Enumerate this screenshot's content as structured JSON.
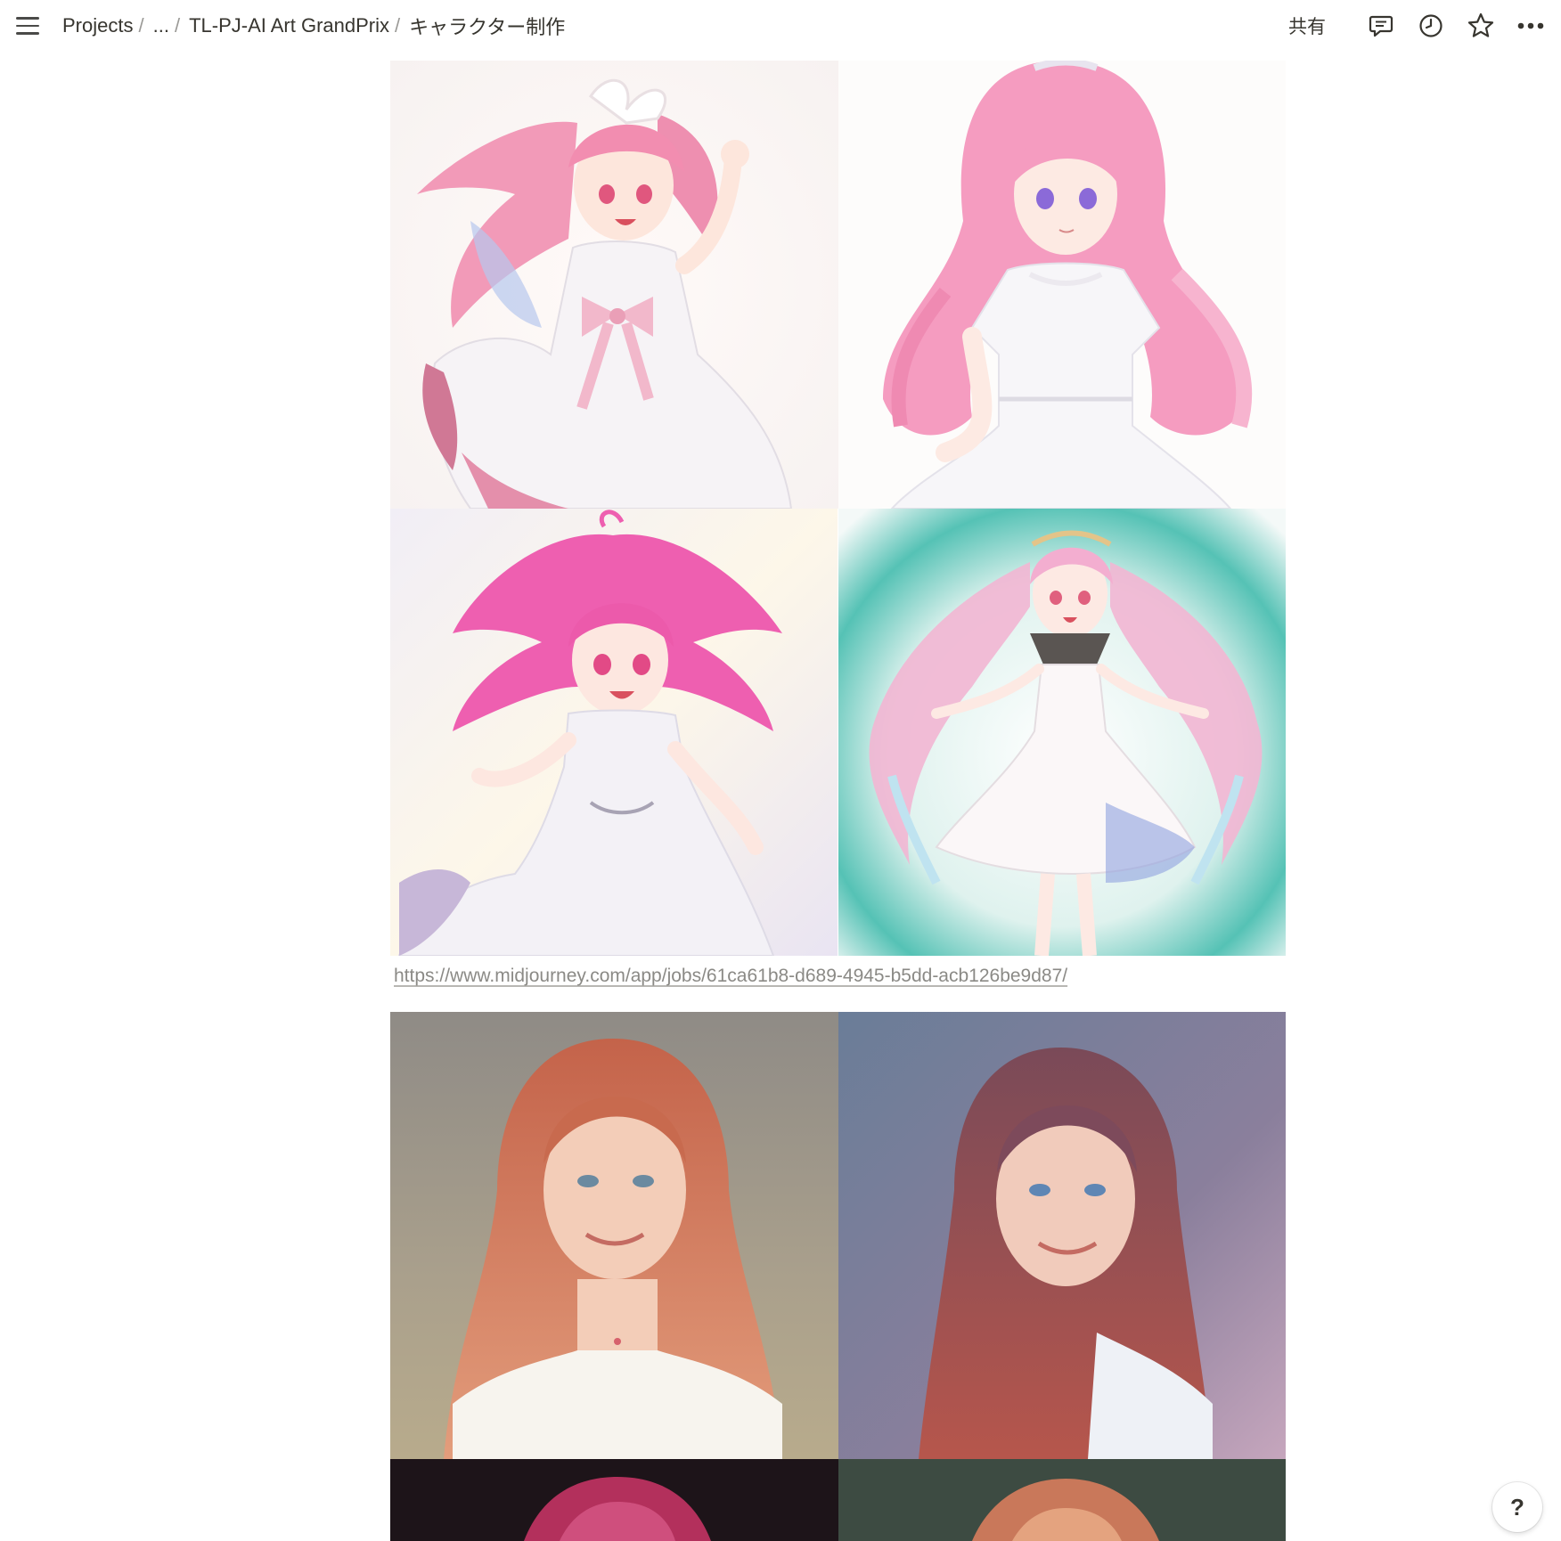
{
  "breadcrumb": {
    "items": [
      {
        "label": "Projects"
      },
      {
        "label": "..."
      },
      {
        "label": "TL-PJ-AI Art GrandPrix"
      },
      {
        "label": "キャラクター制作"
      }
    ],
    "separator": "/"
  },
  "top_actions": {
    "share_label": "共有",
    "icons": [
      "comments-icon",
      "history-clock-icon",
      "favorite-star-icon",
      "more-options-icon"
    ]
  },
  "gallery_1": {
    "images": [
      {
        "name": "anime-girl-pink-hair-white-dress-ribbon"
      },
      {
        "name": "anime-girl-long-pink-hair-purple-eyes"
      },
      {
        "name": "anime-girl-magenta-hair-white-dress"
      },
      {
        "name": "anime-girl-twintails-pink-hair-teal-background"
      }
    ]
  },
  "link": {
    "text": "https://www.midjourney.com/app/jobs/61ca61b8-d689-4945-b5dd-acb126be9d87/"
  },
  "gallery_2": {
    "images": [
      {
        "name": "portrait-girl-red-hair-freckles-grey-background"
      },
      {
        "name": "portrait-girl-auburn-hair-freckles-blue-background"
      },
      {
        "name": "portrait-girl-red-hair-dark-background"
      },
      {
        "name": "portrait-girl-strawberry-hair-green-background"
      }
    ]
  },
  "help": {
    "label": "?"
  },
  "colors": {
    "text": "#37352f",
    "muted": "#9b9a97",
    "link": "#8b8a86"
  }
}
